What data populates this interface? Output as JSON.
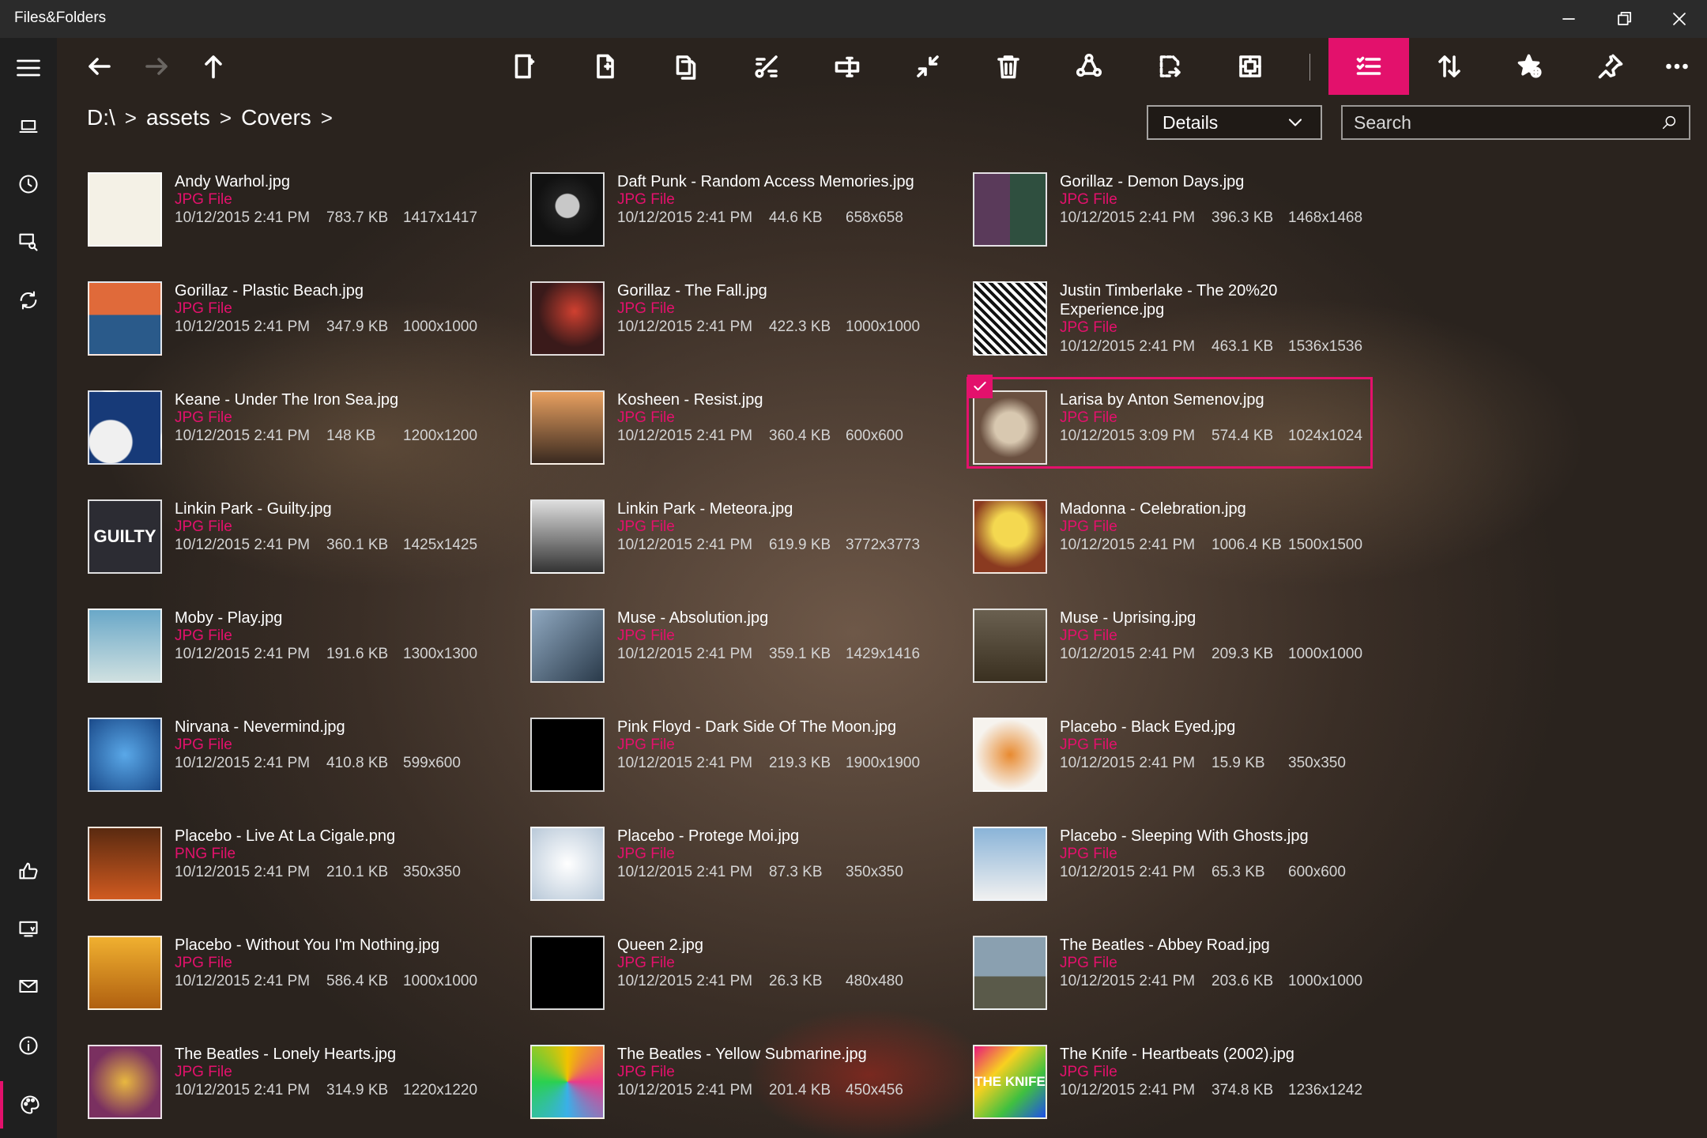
{
  "app": {
    "title": "Files&Folders"
  },
  "window_buttons": [
    {
      "name": "minimize-button",
      "glyph": "—"
    },
    {
      "name": "restore-button",
      "glyph": "❐"
    },
    {
      "name": "close-button",
      "glyph": "✕"
    }
  ],
  "toolbar": {
    "buttons": [
      {
        "name": "new-folder-icon"
      },
      {
        "name": "new-file-icon"
      },
      {
        "name": "copy-icon"
      },
      {
        "name": "cut-icon"
      },
      {
        "name": "rename-icon"
      },
      {
        "name": "compress-icon"
      },
      {
        "name": "delete-icon"
      },
      {
        "name": "share-icon"
      },
      {
        "name": "open-with-icon"
      },
      {
        "name": "select-all-icon"
      }
    ],
    "right_buttons": [
      {
        "name": "selection-mode-icon",
        "active": true
      },
      {
        "name": "sort-icon"
      },
      {
        "name": "favorite-icon"
      },
      {
        "name": "pin-icon"
      },
      {
        "name": "more-icon"
      }
    ]
  },
  "breadcrumb": {
    "parts": [
      "D:\\",
      "assets",
      "Covers"
    ],
    "separator": ">"
  },
  "view": {
    "selected": "Details"
  },
  "search": {
    "placeholder": "Search"
  },
  "accent": "#e3116c",
  "files": [
    {
      "name": "Andy Warhol.jpg",
      "type": "JPG File",
      "date": "10/12/2015 2:41 PM",
      "size": "783.7 KB",
      "dims": "1417x1417"
    },
    {
      "name": "Daft Punk - Random Access Memories.jpg",
      "type": "JPG File",
      "date": "10/12/2015 2:41 PM",
      "size": "44.6 KB",
      "dims": "658x658"
    },
    {
      "name": "Gorillaz - Demon Days.jpg",
      "type": "JPG File",
      "date": "10/12/2015 2:41 PM",
      "size": "396.3 KB",
      "dims": "1468x1468"
    },
    {
      "name": "Gorillaz - Plastic Beach.jpg",
      "type": "JPG File",
      "date": "10/12/2015 2:41 PM",
      "size": "347.9 KB",
      "dims": "1000x1000"
    },
    {
      "name": "Gorillaz - The Fall.jpg",
      "type": "JPG File",
      "date": "10/12/2015 2:41 PM",
      "size": "422.3 KB",
      "dims": "1000x1000"
    },
    {
      "name": "Justin Timberlake - The 20%20 Experience.jpg",
      "type": "JPG File",
      "date": "10/12/2015 2:41 PM",
      "size": "463.1 KB",
      "dims": "1536x1536"
    },
    {
      "name": "Keane - Under The Iron Sea.jpg",
      "type": "JPG File",
      "date": "10/12/2015 2:41 PM",
      "size": "148 KB",
      "dims": "1200x1200"
    },
    {
      "name": "Kosheen - Resist.jpg",
      "type": "JPG File",
      "date": "10/12/2015 2:41 PM",
      "size": "360.4 KB",
      "dims": "600x600"
    },
    {
      "name": "Larisa by Anton Semenov.jpg",
      "type": "JPG File",
      "date": "10/12/2015 3:09 PM",
      "size": "574.4 KB",
      "dims": "1024x1024",
      "selected": true
    },
    {
      "name": "Linkin Park - Guilty.jpg",
      "type": "JPG File",
      "date": "10/12/2015 2:41 PM",
      "size": "360.1 KB",
      "dims": "1425x1425"
    },
    {
      "name": "Linkin Park - Meteora.jpg",
      "type": "JPG File",
      "date": "10/12/2015 2:41 PM",
      "size": "619.9 KB",
      "dims": "3772x3773"
    },
    {
      "name": "Madonna - Celebration.jpg",
      "type": "JPG File",
      "date": "10/12/2015 2:41 PM",
      "size": "1006.4 KB",
      "dims": "1500x1500"
    },
    {
      "name": "Moby - Play.jpg",
      "type": "JPG File",
      "date": "10/12/2015 2:41 PM",
      "size": "191.6 KB",
      "dims": "1300x1300"
    },
    {
      "name": "Muse - Absolution.jpg",
      "type": "JPG File",
      "date": "10/12/2015 2:41 PM",
      "size": "359.1 KB",
      "dims": "1429x1416"
    },
    {
      "name": "Muse - Uprising.jpg",
      "type": "JPG File",
      "date": "10/12/2015 2:41 PM",
      "size": "209.3 KB",
      "dims": "1000x1000"
    },
    {
      "name": "Nirvana - Nevermind.jpg",
      "type": "JPG File",
      "date": "10/12/2015 2:41 PM",
      "size": "410.8 KB",
      "dims": "599x600"
    },
    {
      "name": "Pink Floyd - Dark Side Of The Moon.jpg",
      "type": "JPG File",
      "date": "10/12/2015 2:41 PM",
      "size": "219.3 KB",
      "dims": "1900x1900"
    },
    {
      "name": "Placebo - Black Eyed.jpg",
      "type": "JPG File",
      "date": "10/12/2015 2:41 PM",
      "size": "15.9 KB",
      "dims": "350x350"
    },
    {
      "name": "Placebo - Live At La Cigale.png",
      "type": "PNG File",
      "date": "10/12/2015 2:41 PM",
      "size": "210.1 KB",
      "dims": "350x350"
    },
    {
      "name": "Placebo - Protege Moi.jpg",
      "type": "JPG File",
      "date": "10/12/2015 2:41 PM",
      "size": "87.3 KB",
      "dims": "350x350"
    },
    {
      "name": "Placebo - Sleeping With Ghosts.jpg",
      "type": "JPG File",
      "date": "10/12/2015 2:41 PM",
      "size": "65.3 KB",
      "dims": "600x600"
    },
    {
      "name": "Placebo - Without You I'm Nothing.jpg",
      "type": "JPG File",
      "date": "10/12/2015 2:41 PM",
      "size": "586.4 KB",
      "dims": "1000x1000"
    },
    {
      "name": "Queen 2.jpg",
      "type": "JPG File",
      "date": "10/12/2015 2:41 PM",
      "size": "26.3 KB",
      "dims": "480x480"
    },
    {
      "name": "The Beatles - Abbey Road.jpg",
      "type": "JPG File",
      "date": "10/12/2015 2:41 PM",
      "size": "203.6 KB",
      "dims": "1000x1000"
    },
    {
      "name": "The Beatles - Lonely Hearts.jpg",
      "type": "JPG File",
      "date": "10/12/2015 2:41 PM",
      "size": "314.9 KB",
      "dims": "1220x1220"
    },
    {
      "name": "The Beatles - Yellow Submarine.jpg",
      "type": "JPG File",
      "date": "10/12/2015 2:41 PM",
      "size": "201.4 KB",
      "dims": "450x456"
    },
    {
      "name": "The Knife - Heartbeats (2002).jpg",
      "type": "JPG File",
      "date": "10/12/2015 2:41 PM",
      "size": "374.8 KB",
      "dims": "1236x1242"
    }
  ],
  "thumb_text": {
    "guilty": "GUILTY",
    "knife": "THE KNIFE"
  }
}
